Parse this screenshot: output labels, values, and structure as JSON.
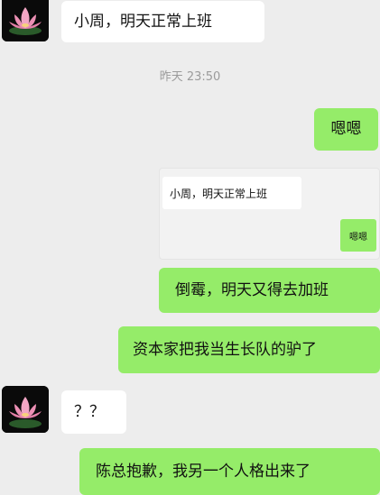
{
  "chat": {
    "timestamp": "昨天 23:50",
    "messages": [
      {
        "side": "left",
        "text": "小周，明天正常上班"
      },
      {
        "side": "right",
        "text": "嗯嗯"
      },
      {
        "side": "right",
        "text": "倒霉，明天又得去加班"
      },
      {
        "side": "right",
        "text": "资本家把我当生长队的驴了"
      },
      {
        "side": "left",
        "text": "？？"
      },
      {
        "side": "right",
        "text": "陈总抱歉，我另一个人格出来了"
      }
    ],
    "quoted_screenshot": {
      "left_text": "小周，明天正常上班",
      "right_text": "嗯嗯"
    }
  },
  "colors": {
    "background": "#ededed",
    "own_bubble": "#95ec69",
    "other_bubble": "#ffffff"
  },
  "icons": {
    "contact_avatar": "pink-lotus-avatar-icon"
  }
}
